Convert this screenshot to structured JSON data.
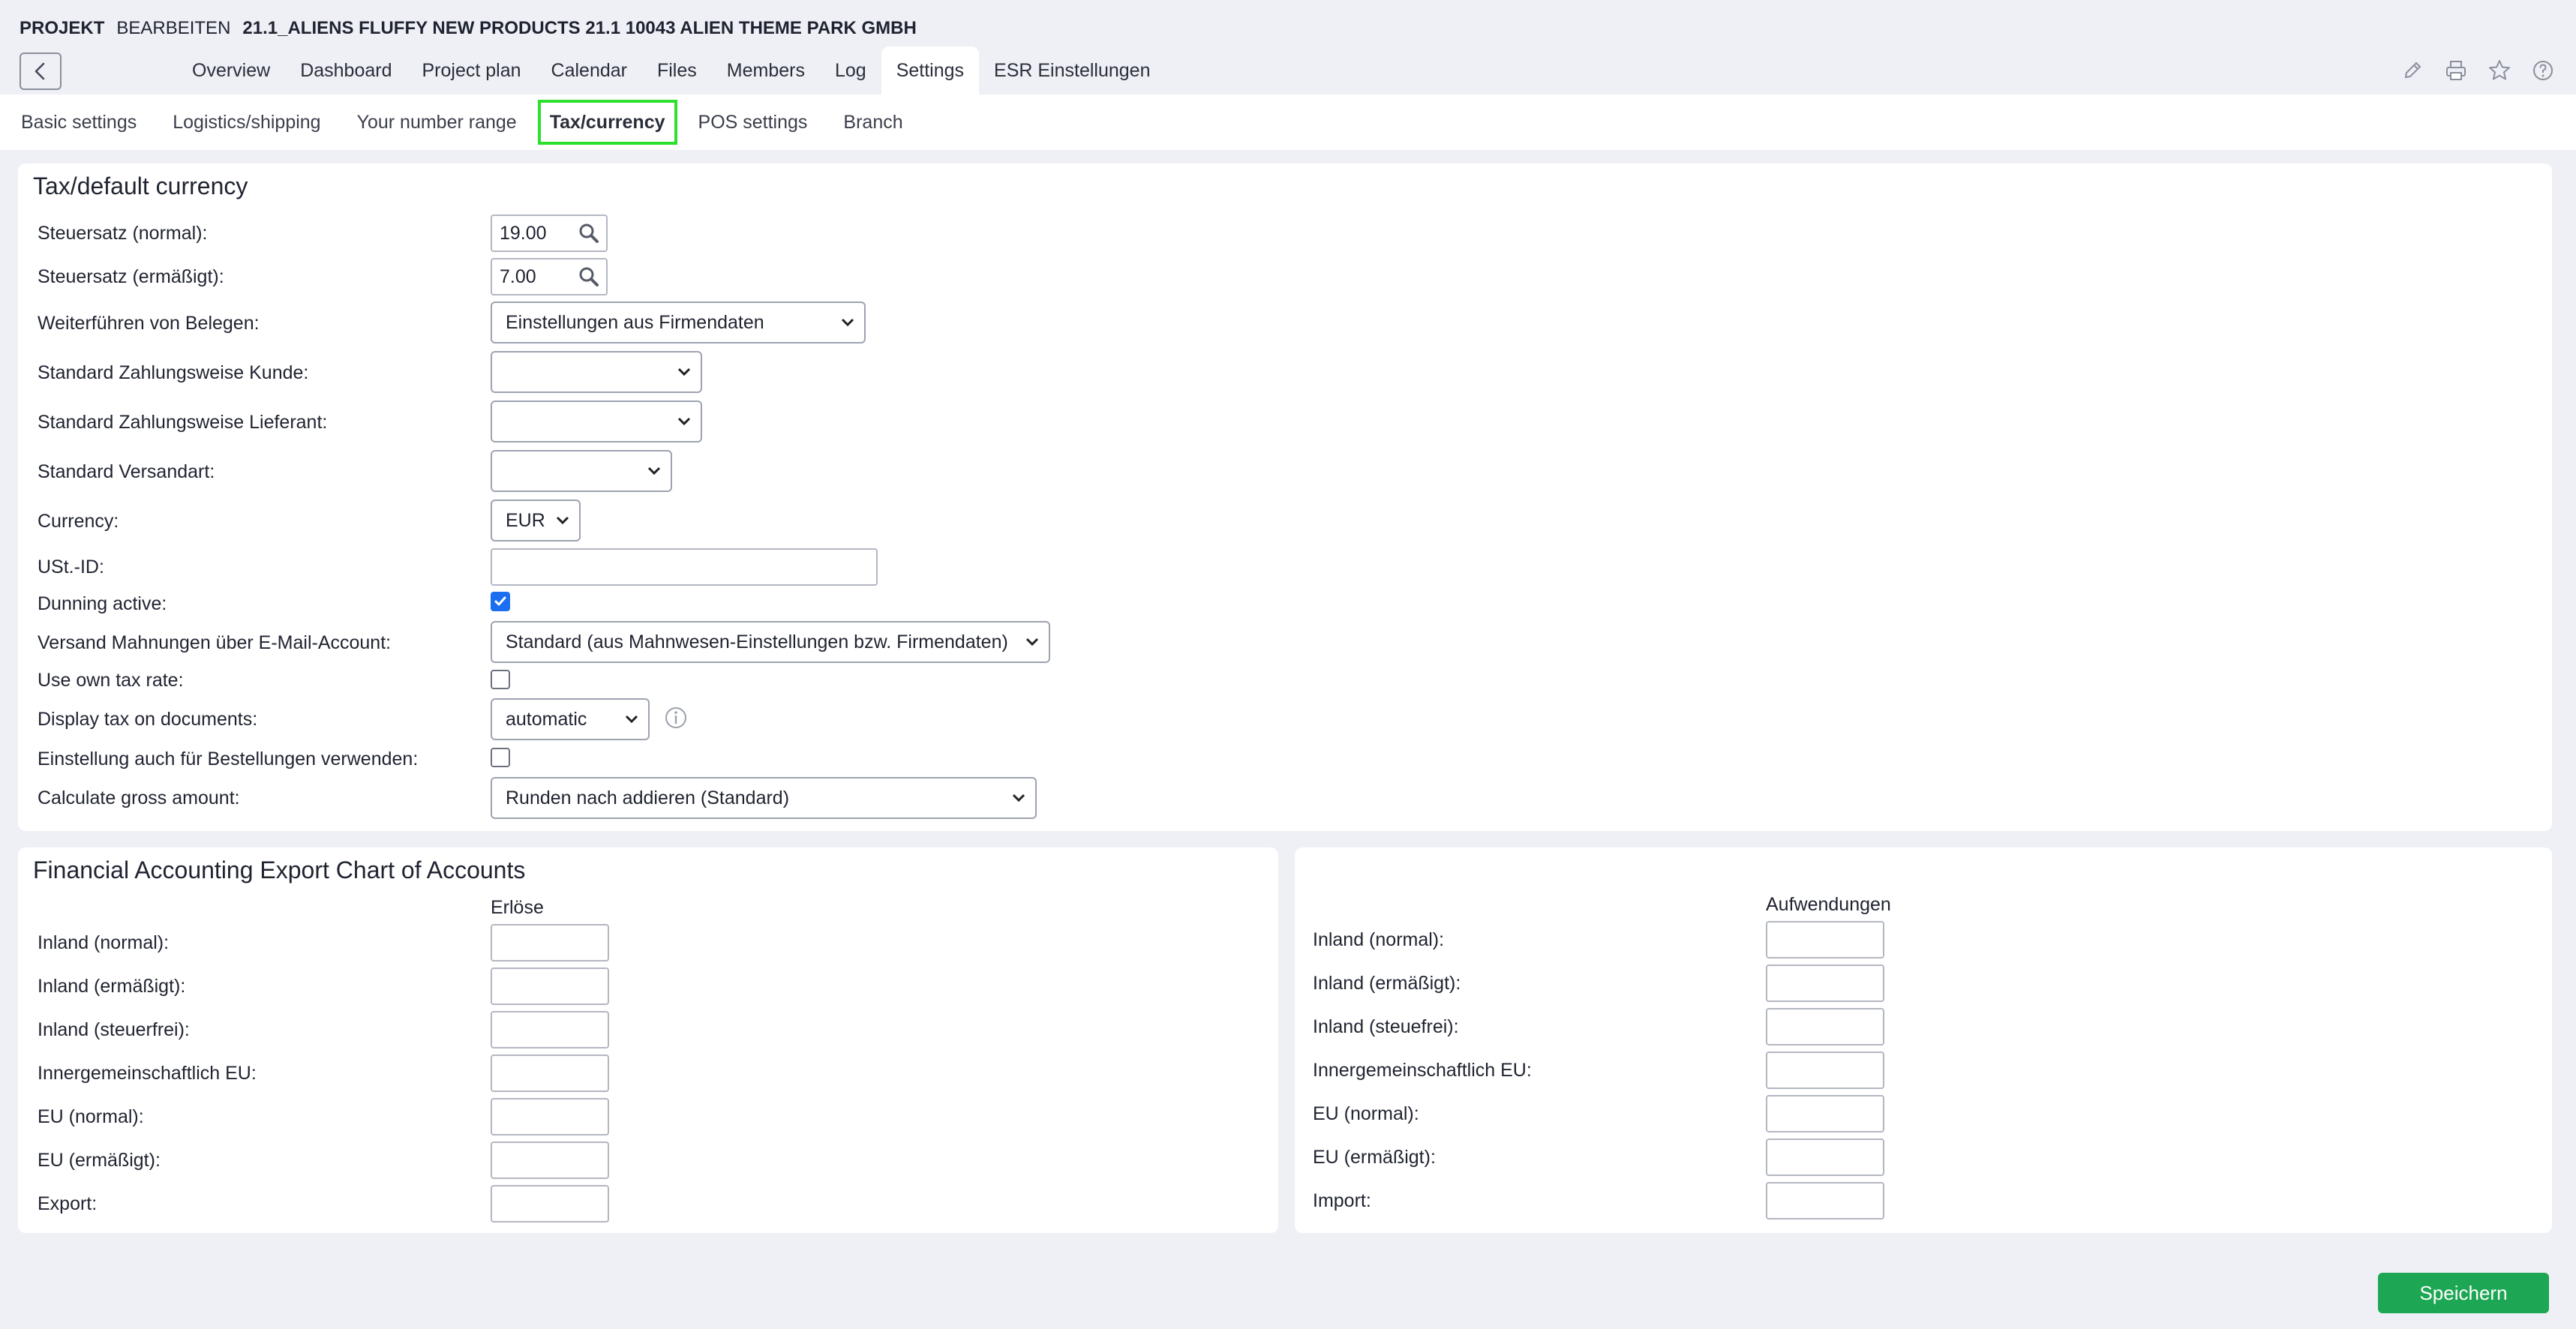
{
  "header": {
    "module": "PROJEKT",
    "mode": "BEARBEITEN",
    "project_name": "21.1_ALIENS FLUFFY NEW PRODUCTS 21.1 10043 ALIEN THEME PARK GMBH"
  },
  "nav": {
    "items": [
      "Overview",
      "Dashboard",
      "Project plan",
      "Calendar",
      "Files",
      "Members",
      "Log",
      "Settings",
      "ESR Einstellungen"
    ],
    "active": "Settings"
  },
  "subnav": {
    "items": [
      "Basic settings",
      "Logistics/shipping",
      "Your number range",
      "Tax/currency",
      "POS settings",
      "Branch"
    ],
    "active": "Tax/currency"
  },
  "tax_panel": {
    "title": "Tax/default currency",
    "steuersatz_normal": {
      "label": "Steuersatz (normal):",
      "value": "19.00"
    },
    "steuersatz_ermaessigt": {
      "label": "Steuersatz (ermäßigt):",
      "value": "7.00"
    },
    "weiterfuehren": {
      "label": "Weiterführen von Belegen:",
      "value": "Einstellungen aus Firmendaten"
    },
    "zahlungsweise_kunde": {
      "label": "Standard Zahlungsweise Kunde:",
      "value": ""
    },
    "zahlungsweise_lieferant": {
      "label": "Standard Zahlungsweise Lieferant:",
      "value": ""
    },
    "versandart": {
      "label": "Standard Versandart:",
      "value": ""
    },
    "currency": {
      "label": "Currency:",
      "value": "EUR"
    },
    "ust_id": {
      "label": "USt.-ID:",
      "value": ""
    },
    "dunning_active": {
      "label": "Dunning active:",
      "checked": true
    },
    "versand_mahnungen": {
      "label": "Versand Mahnungen über E-Mail-Account:",
      "value": "Standard (aus Mahnwesen-Einstellungen bzw. Firmendaten)"
    },
    "own_tax_rate": {
      "label": "Use own tax rate:",
      "checked": false
    },
    "display_tax": {
      "label": "Display tax on documents:",
      "value": "automatic"
    },
    "einstellung_bestellungen": {
      "label": "Einstellung auch für Bestellungen verwenden:",
      "checked": false
    },
    "gross_amount": {
      "label": "Calculate gross amount:",
      "value": "Runden nach addieren (Standard)"
    }
  },
  "accounts_panel": {
    "title": "Financial Accounting Export Chart of Accounts",
    "revenue_header": "Erlöse",
    "revenue_rows": [
      "Inland (normal):",
      "Inland (ermäßigt):",
      "Inland (steuerfrei):",
      "Innergemeinschaftlich EU:",
      "EU (normal):",
      "EU (ermäßigt):",
      "Export:"
    ],
    "expense_header": "Aufwendungen",
    "expense_rows": [
      "Inland (normal):",
      "Inland (ermäßigt):",
      "Inland (steuefrei):",
      "Innergemeinschaftlich EU:",
      "EU (normal):",
      "EU (ermäßigt):",
      "Import:"
    ]
  },
  "actions": {
    "save_label": "Speichern"
  },
  "colors": {
    "accent": "#1c6ef0",
    "save": "#1da653",
    "highlight": "#2ee02e",
    "background": "#eef0f6"
  }
}
